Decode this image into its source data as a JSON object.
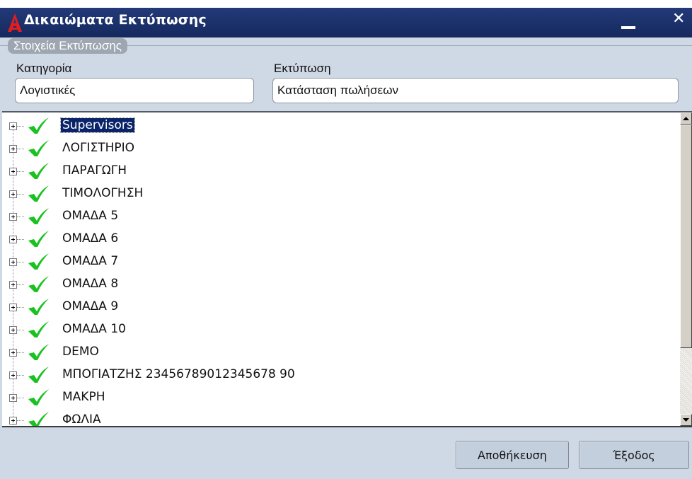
{
  "window": {
    "title": "Δικαιώματα Εκτύπωσης",
    "close_glyph": "✕"
  },
  "group": {
    "label": "Στοιχεία Εκτύπωσης"
  },
  "fields": {
    "category_label": "Κατηγορία",
    "category_value": "Λογιστικές",
    "print_label": "Εκτύπωση",
    "print_value": "Κατάσταση πωλήσεων"
  },
  "tree": {
    "items": [
      {
        "label": "Supervisors",
        "selected": true
      },
      {
        "label": "ΛΟΓΙΣΤΗΡΙΟ"
      },
      {
        "label": "ΠΑΡΑΓΩΓΗ"
      },
      {
        "label": "ΤΙΜΟΛΟΓΗΣΗ"
      },
      {
        "label": "ΟΜΑΔΑ 5"
      },
      {
        "label": "ΟΜΑΔΑ 6"
      },
      {
        "label": "ΟΜΑΔΑ 7"
      },
      {
        "label": "ΟΜΑΔΑ 8"
      },
      {
        "label": "ΟΜΑΔΑ 9"
      },
      {
        "label": "ΟΜΑΔΑ 10"
      },
      {
        "label": "DEMO"
      },
      {
        "label": "ΜΠΟΓΙΑΤΖΗΣ 23456789012345678 90"
      },
      {
        "label": "ΜΑΚΡΗ"
      },
      {
        "label": "ΦΩΛΙΑ"
      }
    ]
  },
  "footer": {
    "save_label": "Αποθήκευση",
    "exit_label": "Έξοδος"
  },
  "colors": {
    "titlebar": "#1b3168",
    "dialog_bg": "#cfd9e6",
    "check": "#19c21f",
    "selection": "#0a246a"
  },
  "icons": {
    "app": "app-logo-icon",
    "item": "checkmark-icon",
    "expander": "plus-expander-icon"
  }
}
